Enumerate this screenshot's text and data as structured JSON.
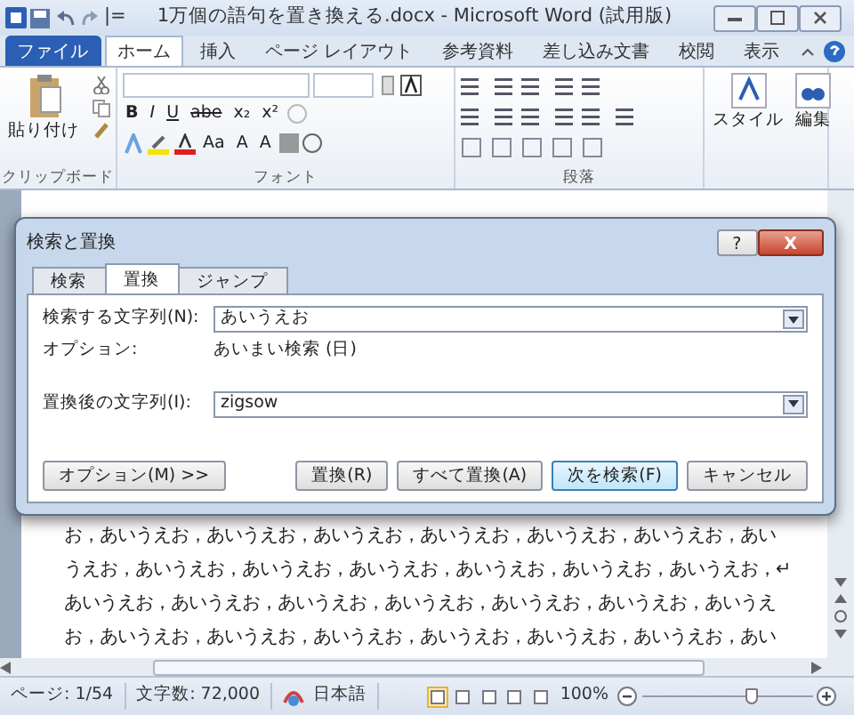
{
  "window": {
    "title": "1万個の語句を置き換える.docx - Microsoft Word (試用版)",
    "quick_access_separator": "|="
  },
  "ribbon": {
    "tabs": [
      {
        "label": "ファイル",
        "kind": "file",
        "selected": false
      },
      {
        "label": "ホーム",
        "kind": "tab",
        "selected": true
      },
      {
        "label": "挿入",
        "kind": "tab",
        "selected": false
      },
      {
        "label": "ページ レイアウト",
        "kind": "tab",
        "selected": false
      },
      {
        "label": "参考資料",
        "kind": "tab",
        "selected": false
      },
      {
        "label": "差し込み文書",
        "kind": "tab",
        "selected": false
      },
      {
        "label": "校閲",
        "kind": "tab",
        "selected": false
      },
      {
        "label": "表示",
        "kind": "tab",
        "selected": false
      }
    ],
    "paste_label": "貼り付け",
    "format_buttons": [
      "B",
      "I",
      "U",
      "abe",
      "x₂",
      "x²"
    ],
    "font_buttons": [
      "Aa",
      "A",
      "A"
    ],
    "style_label": "スタイル",
    "edit_label": "編集",
    "groups": [
      {
        "label": "クリップボード",
        "kind": "clipboard"
      },
      {
        "label": "フォント",
        "kind": "font"
      },
      {
        "label": "段落",
        "kind": "paragraph"
      },
      {
        "kind": "styles"
      }
    ]
  },
  "document": {
    "lines": [
      "お，あいうえお，あいうえお，あいうえお，あいうえお，あいうえお，あいうえお，あい",
      "うえお，あいうえお，あいうえお，あいうえお，あいうえお，あいうえお，あいうえお，↵",
      "あいうえお，あいうえお，あいうえお，あいうえお，あいうえお，あいうえお，あいうえ",
      "お，あいうえお，あいうえお，あいうえお，あいうえお，あいうえお，あいうえお，あい"
    ]
  },
  "dialog": {
    "title": "検索と置換",
    "help": "?",
    "close": "X",
    "tabs": [
      {
        "label": "検索",
        "selected": false
      },
      {
        "label": "置換",
        "selected": true
      },
      {
        "label": "ジャンプ",
        "selected": false
      }
    ],
    "find_label": "検索する文字列(N):",
    "find_value": "あいうえお",
    "options_label": "オプション:",
    "options_value": "あいまい検索 (日)",
    "replace_label": "置換後の文字列(I):",
    "replace_value": "zigsow",
    "buttons": [
      {
        "label": "オプション(M) >>",
        "kind": "left",
        "selected": false
      },
      {
        "label": "置換(R)",
        "kind": "right",
        "selected": false
      },
      {
        "label": "すべて置換(A)",
        "kind": "right",
        "selected": false
      },
      {
        "label": "次を検索(F)",
        "kind": "right",
        "selected": true
      },
      {
        "label": "キャンセル",
        "kind": "right",
        "selected": false
      }
    ]
  },
  "status_bar": {
    "page": "ページ: 1/54",
    "words": "文字数: 72,000",
    "language": "日本語",
    "zoom": "100%",
    "views": [
      {
        "selected": true
      },
      {
        "selected": false
      },
      {
        "selected": false
      },
      {
        "selected": false
      },
      {
        "selected": false
      }
    ],
    "zoom_slider": {
      "level": 0.66
    }
  }
}
